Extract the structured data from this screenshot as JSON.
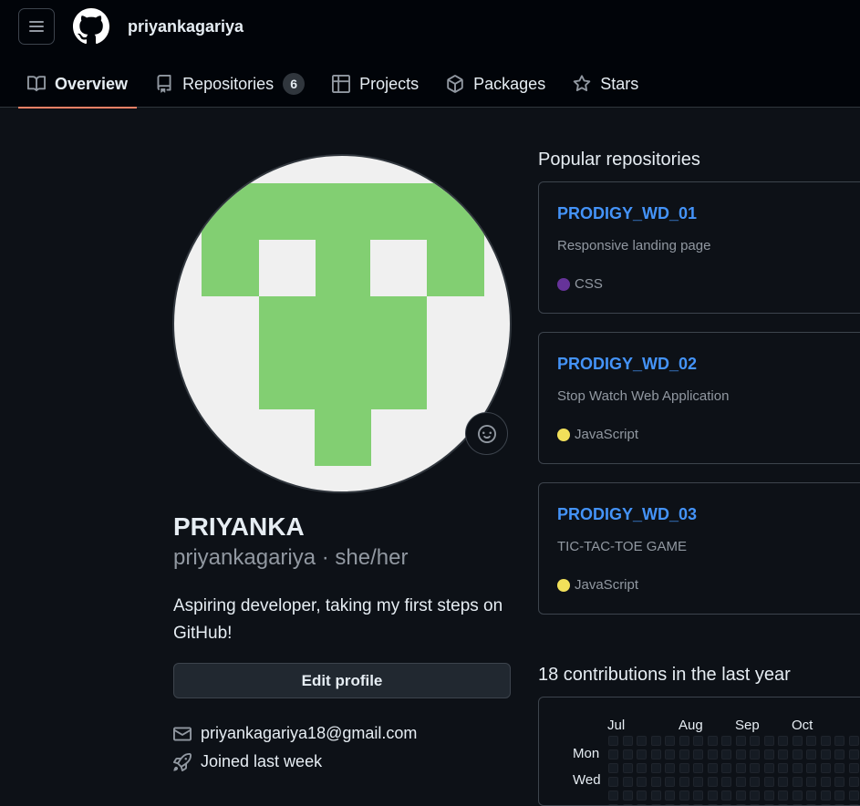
{
  "header": {
    "username": "priyankagariya",
    "menu_icon": "hamburger-menu-icon",
    "logo_icon": "github-logo-icon"
  },
  "tabs": [
    {
      "label": "Overview",
      "icon": "book-icon",
      "active": true
    },
    {
      "label": "Repositories",
      "icon": "repo-icon",
      "count": "6"
    },
    {
      "label": "Projects",
      "icon": "table-icon"
    },
    {
      "label": "Packages",
      "icon": "package-icon"
    },
    {
      "label": "Stars",
      "icon": "star-icon"
    }
  ],
  "profile": {
    "name": "PRIYANKA",
    "handle": "priyankagariya · she/her",
    "bio": "Aspiring developer, taking my first steps on GitHub!",
    "edit_label": "Edit profile",
    "email": "priyankagariya18@gmail.com",
    "joined": "Joined last week",
    "avatar_color": "#82cf72"
  },
  "popular": {
    "title": "Popular repositories",
    "repos": [
      {
        "name": "PRODIGY_WD_01",
        "description": "Responsive landing page",
        "language": "CSS",
        "color": "#663399"
      },
      {
        "name": "PRODIGY_WD_02",
        "description": "Stop Watch Web Application",
        "language": "JavaScript",
        "color": "#f1e05a"
      },
      {
        "name": "PRODIGY_WD_03",
        "description": "TIC-TAC-TOE GAME",
        "language": "JavaScript",
        "color": "#f1e05a"
      }
    ]
  },
  "contributions": {
    "title": "18 contributions in the last year",
    "months": [
      "Jul",
      "Aug",
      "Sep",
      "Oct"
    ],
    "days": [
      "Mon",
      "Wed"
    ]
  },
  "colors": {
    "accent_tab": "#f78166",
    "link": "#4493f8",
    "background": "#0d1117"
  }
}
